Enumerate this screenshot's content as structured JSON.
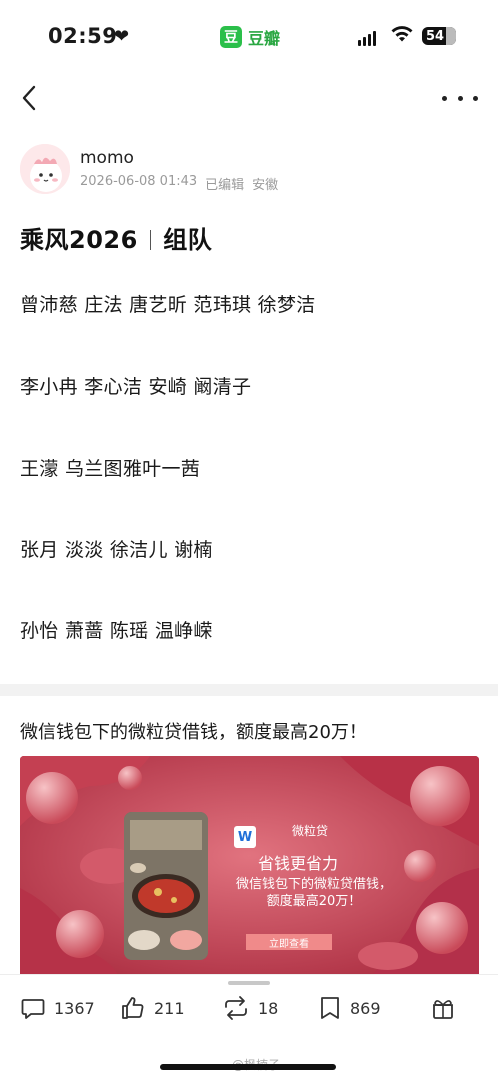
{
  "status_bar": {
    "time": "02:59",
    "app_icon_glyph": "豆",
    "app_name": "豆瓣",
    "battery": "54"
  },
  "nav": {
    "back_icon": "chevron-left-icon",
    "more_icon": "more-icon"
  },
  "author": {
    "name": "momo",
    "datetime": "2026-06-08 01:43",
    "edited": "已编辑",
    "location": "安徽"
  },
  "post": {
    "title_main": "乘风2026",
    "title_sub": "组队",
    "teams": [
      "曾沛慈 庄法 唐艺昕 范玮琪 徐梦洁",
      "李小冉 李心洁 安崎 阚清子",
      "王濛 乌兰图雅叶一茜",
      "张月 淡淡 徐洁儿 谢楠",
      "孙怡 萧蔷 陈瑶 温峥嵘"
    ]
  },
  "ad": {
    "title": "微信钱包下的微粒贷借钱，额度最高20万！",
    "logo_glyph": "W",
    "brand": "微粒贷",
    "slogan": "省钱更省力",
    "description": "微信钱包下的微粒贷借钱，额度最高20万！",
    "cta": "立即查看"
  },
  "actions": {
    "comments": "1367",
    "likes": "211",
    "reposts": "18",
    "collects": "869"
  },
  "watermark": "@枫楠子一"
}
